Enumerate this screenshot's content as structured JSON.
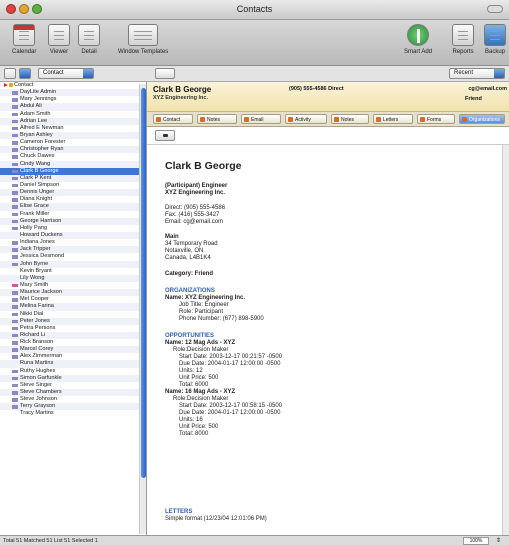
{
  "window": {
    "title": "Contacts"
  },
  "toolbar": {
    "calendar": "Calendar",
    "viewer": "Viewer",
    "detail": "Detail",
    "window_templates": "Window Templates",
    "smart_add": "Smart Add",
    "reports": "Reports",
    "backup": "Backup"
  },
  "left_controls": {
    "filter_value": "Contact"
  },
  "contacts": [
    {
      "label": "Contact",
      "type": "group"
    },
    {
      "label": "DayLite Admin"
    },
    {
      "label": "Mary Jennings"
    },
    {
      "label": "Abdul Ali"
    },
    {
      "label": "Adam Smith"
    },
    {
      "label": "Adrian Lee"
    },
    {
      "label": "Alfred E Newman"
    },
    {
      "label": "Bryan Ashley"
    },
    {
      "label": "Cameron Forester"
    },
    {
      "label": "Christopher Ryan"
    },
    {
      "label": "Chuck Dawes"
    },
    {
      "label": "Cindy Wang"
    },
    {
      "label": "Clark B George",
      "selected": true
    },
    {
      "label": "Clark P Kent"
    },
    {
      "label": "Daniel Simpson"
    },
    {
      "label": "Dennis Unger"
    },
    {
      "label": "Diana Knight"
    },
    {
      "label": "Elise Grace"
    },
    {
      "label": "Frank Miller"
    },
    {
      "label": "George Harrison"
    },
    {
      "label": "Holly Pang"
    },
    {
      "label": "Howard Duckens",
      "noicon": true
    },
    {
      "label": "Indiana Jones"
    },
    {
      "label": "Jack Tripper"
    },
    {
      "label": "Jessica Desmond"
    },
    {
      "label": "John Byrne"
    },
    {
      "label": "Kevin Bryant",
      "noicon": true
    },
    {
      "label": "Lily Wong",
      "noicon": true
    },
    {
      "label": "Mary Smith",
      "red": true
    },
    {
      "label": "Maurice Jackson"
    },
    {
      "label": "Mel Cooper"
    },
    {
      "label": "Melina Farina"
    },
    {
      "label": "Nikki Dial"
    },
    {
      "label": "Peter Jones"
    },
    {
      "label": "Petra Persons"
    },
    {
      "label": "Richard Li"
    },
    {
      "label": "Rick Branson"
    },
    {
      "label": "Marcel Corey"
    },
    {
      "label": "Alex Zimmerman"
    },
    {
      "label": "Runa Martins",
      "noicon": true
    },
    {
      "label": "Ruthy Hughes"
    },
    {
      "label": "Simon Garfunkle"
    },
    {
      "label": "Steve Singer"
    },
    {
      "label": "Steve Chambers"
    },
    {
      "label": "Steve Johnson"
    },
    {
      "label": "Terry Grayson"
    },
    {
      "label": "Tracy Martins",
      "noicon": true
    }
  ],
  "right_controls": {
    "recent": "Recent"
  },
  "header": {
    "name": "Clark B George",
    "company": "XYZ Engineering Inc.",
    "phone": "(905) 555-4586 Direct",
    "email": "cg@email.com",
    "category": "Friend"
  },
  "tabs": [
    "Contact",
    "Notes",
    "Email",
    "Activity",
    "Notes",
    "Letters",
    "Forms",
    "Organizations"
  ],
  "detail": {
    "name": "Clark B George",
    "role": "(Participant) Engineer",
    "company": "XYZ Engineering Inc.",
    "direct": "Direct: (905) 555-4586",
    "fax": "Fax: (416) 555-3427",
    "email": "Email: cg@email.com",
    "address_label": "Main",
    "address1": "34 Temporary Road",
    "address2": "Notaxville, ON",
    "address3": "Canada, L4B1K4",
    "category": "Category: Friend",
    "org_heading": "ORGANIZATIONS",
    "org_name": "Name: XYZ Engineering Inc.",
    "org_title": "Job Title: Engineer",
    "org_role": "Role: Participant",
    "org_phone": "Phone Number: (677) 898-5900",
    "opp_heading": "OPPORTUNITIES",
    "opp1_name": "Name: 12 Mag Ads - XYZ",
    "opp1_role": "Role:Decision Maker",
    "opp1_start": "Start Date: 2003-12-17 00:21:57 -0500",
    "opp1_due": "Due Date: 2004-01-17 12:00:00 -0500",
    "opp1_units": "Units: 12",
    "opp1_unit_price": "Unit Price: 500",
    "opp1_total": "Total: 6000",
    "opp2_name": "Name: 16 Mag Ads - XYZ",
    "opp2_role": "Role:Decision Maker",
    "opp2_start": "Start Date: 2003-12-17 00:58:15 -0500",
    "opp2_due": "Due Date: 2004-01-17 12:00:00 -0500",
    "opp2_units": "Units: 16",
    "opp2_unit_price": "Unit Price: 500",
    "opp2_total": "Total: 8000",
    "letters_heading": "LETTERS",
    "letter1": "Simple format (12/23/04 12:01:06 PM)"
  },
  "status": {
    "text": "Total 51 Matched 51 List 51 Selected 1",
    "zoom": "100%"
  }
}
